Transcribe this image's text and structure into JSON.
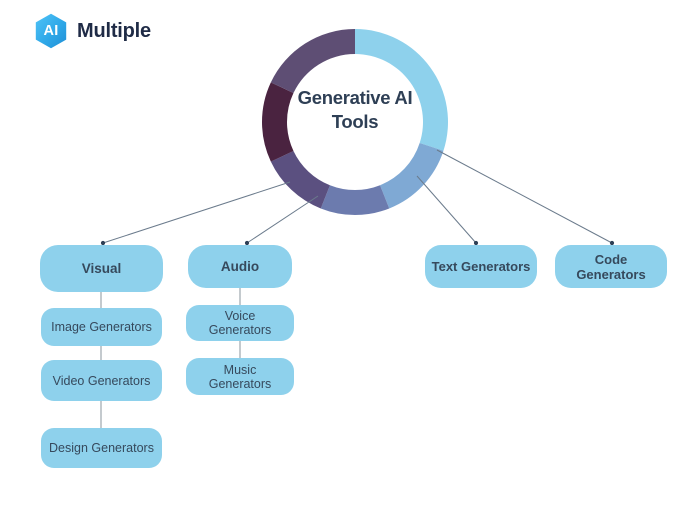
{
  "logo": {
    "mark_text": "AI",
    "word": "Multiple",
    "mark_color": "#2fa8e8",
    "word_color": "#1f2b46"
  },
  "hub": {
    "title_line1": "Generative AI",
    "title_line2": "Tools",
    "text_color": "#2e3f55"
  },
  "theme": {
    "node_fill": "#8ed1ec",
    "node_text": "#36495c",
    "connector": "#6b7b8c"
  },
  "chart_data": {
    "type": "pie",
    "title": "Generative AI Tools",
    "subtitle": "",
    "legend": "none",
    "inner_radius": 68,
    "outer_radius": 93,
    "labels": [
      "segment-light-blue",
      "segment-medium-blue",
      "segment-slate-blue",
      "segment-mid-purple",
      "segment-dark-plum",
      "segment-violet-grey"
    ],
    "values": [
      30,
      14,
      12,
      12,
      14,
      18
    ],
    "colors": [
      "#8ed1ec",
      "#7fa9d4",
      "#6c7bae",
      "#5b5080",
      "#4a2340",
      "#5e4e74"
    ],
    "start_angle": -90
  },
  "branches": [
    {
      "id": "visual",
      "head": {
        "label": "Visual"
      },
      "children": [
        {
          "label": "Image Generators"
        },
        {
          "label": "Video Generators"
        },
        {
          "label": "Design Generators"
        }
      ]
    },
    {
      "id": "audio",
      "head": {
        "label": "Audio"
      },
      "children": [
        {
          "label": "Voice Generators"
        },
        {
          "label": "Music Generators"
        }
      ]
    },
    {
      "id": "text",
      "head": {
        "label": "Text Generators"
      },
      "children": []
    },
    {
      "id": "code",
      "head": {
        "label": "Code Generators"
      },
      "children": []
    }
  ]
}
